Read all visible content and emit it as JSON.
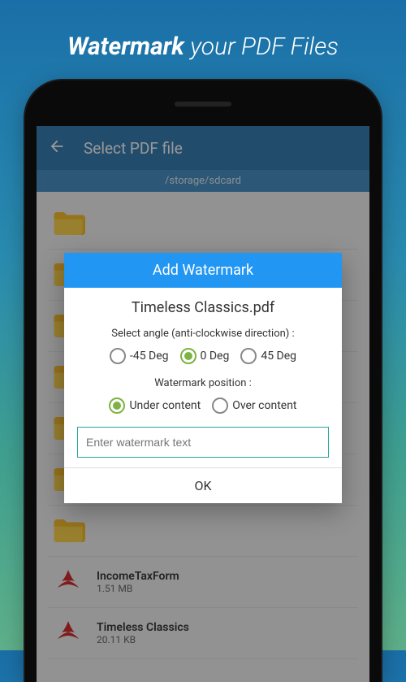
{
  "promo": {
    "bold": "Watermark",
    "rest": " your PDF Files"
  },
  "appbar": {
    "title": "Select PDF file"
  },
  "pathbar": "/storage/sdcard",
  "files": [
    {
      "name": "IncomeTaxForm",
      "size": "1.51 MB"
    },
    {
      "name": "Timeless Classics",
      "size": "20.11 KB"
    }
  ],
  "dialog": {
    "title": "Add Watermark",
    "filename": "Timeless Classics.pdf",
    "angle_label": "Select angle (anti-clockwise direction) :",
    "angles": {
      "a": "-45 Deg",
      "b": "0 Deg",
      "c": "45 Deg"
    },
    "position_label": "Watermark position :",
    "positions": {
      "under": "Under content",
      "over": "Over content"
    },
    "input_placeholder": "Enter watermark text",
    "ok": "OK"
  }
}
